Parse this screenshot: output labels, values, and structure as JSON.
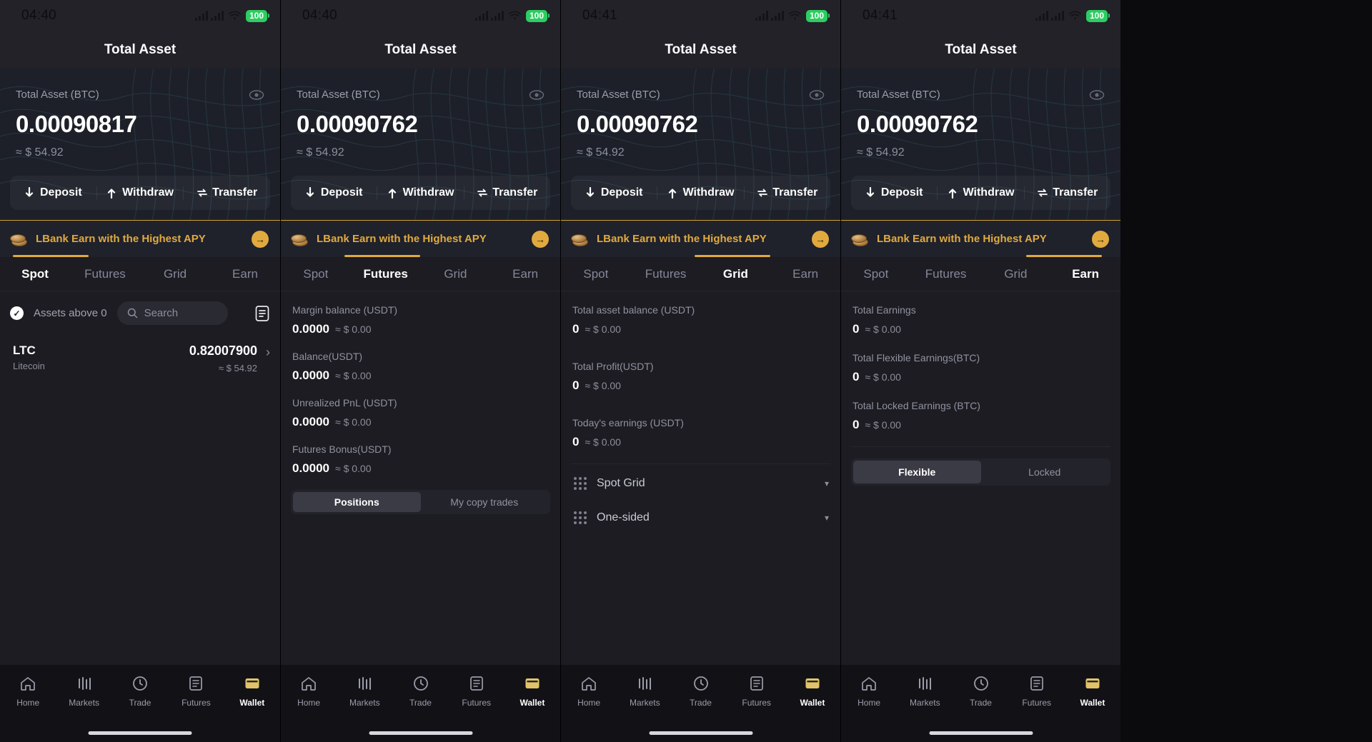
{
  "panels": [
    {
      "statusbar": {
        "time": "04:40",
        "battery": "100"
      },
      "title": "Total Asset",
      "hero": {
        "label": "Total Asset (BTC)",
        "amount": "0.00090817",
        "approx": "≈ $ 54.92",
        "actions": [
          "Deposit",
          "Withdraw",
          "Transfer"
        ]
      },
      "banner": {
        "text": "LBank Earn with the Highest APY",
        "arrow": "→"
      },
      "tabs": [
        "Spot",
        "Futures",
        "Grid",
        "Earn"
      ],
      "active_tab": 0,
      "spot": {
        "filter_label": "Assets above 0",
        "search_placeholder": "Search",
        "asset": {
          "symbol": "LTC",
          "name": "Litecoin",
          "amount": "0.82007900",
          "usd": "≈ $ 54.92"
        }
      },
      "nav": [
        "Home",
        "Markets",
        "Trade",
        "Futures",
        "Wallet"
      ],
      "nav_active": 4
    },
    {
      "statusbar": {
        "time": "04:40",
        "battery": "100"
      },
      "title": "Total Asset",
      "hero": {
        "label": "Total Asset (BTC)",
        "amount": "0.00090762",
        "approx": "≈ $ 54.92",
        "actions": [
          "Deposit",
          "Withdraw",
          "Transfer"
        ]
      },
      "banner": {
        "text": "LBank Earn with the Highest APY",
        "arrow": "→"
      },
      "tabs": [
        "Spot",
        "Futures",
        "Grid",
        "Earn"
      ],
      "active_tab": 1,
      "futures": {
        "stats": [
          {
            "label": "Margin balance (USDT)",
            "value": "0.0000",
            "approx": "≈ $ 0.00"
          },
          {
            "label": "Balance(USDT)",
            "value": "0.0000",
            "approx": "≈ $ 0.00"
          },
          {
            "label": "Unrealized PnL (USDT)",
            "value": "0.0000",
            "approx": "≈ $ 0.00"
          },
          {
            "label": "Futures Bonus(USDT)",
            "value": "0.0000",
            "approx": "≈ $ 0.00"
          }
        ],
        "segments": [
          "Positions",
          "My copy trades"
        ],
        "segment_active": 0
      },
      "nav": [
        "Home",
        "Markets",
        "Trade",
        "Futures",
        "Wallet"
      ],
      "nav_active": 4
    },
    {
      "statusbar": {
        "time": "04:41",
        "battery": "100"
      },
      "title": "Total Asset",
      "hero": {
        "label": "Total Asset (BTC)",
        "amount": "0.00090762",
        "approx": "≈ $ 54.92",
        "actions": [
          "Deposit",
          "Withdraw",
          "Transfer"
        ]
      },
      "banner": {
        "text": "LBank Earn with the Highest APY",
        "arrow": "→"
      },
      "tabs": [
        "Spot",
        "Futures",
        "Grid",
        "Earn"
      ],
      "active_tab": 2,
      "grid": {
        "stats": [
          {
            "label": "Total asset balance (USDT)",
            "value": "0",
            "approx": "≈ $ 0.00"
          },
          {
            "label": "Total Profit(USDT)",
            "value": "0",
            "approx": "≈ $ 0.00"
          },
          {
            "label": "Today's earnings (USDT)",
            "value": "0",
            "approx": "≈ $ 0.00"
          }
        ],
        "rows": [
          {
            "label": "Spot Grid",
            "caret": "▾"
          },
          {
            "label": "One-sided",
            "caret": "▾"
          }
        ]
      },
      "nav": [
        "Home",
        "Markets",
        "Trade",
        "Futures",
        "Wallet"
      ],
      "nav_active": 4
    },
    {
      "statusbar": {
        "time": "04:41",
        "battery": "100"
      },
      "title": "Total Asset",
      "hero": {
        "label": "Total Asset (BTC)",
        "amount": "0.00090762",
        "approx": "≈ $ 54.92",
        "actions": [
          "Deposit",
          "Withdraw",
          "Transfer"
        ]
      },
      "banner": {
        "text": "LBank Earn with the Highest APY",
        "arrow": "→"
      },
      "tabs": [
        "Spot",
        "Futures",
        "Grid",
        "Earn"
      ],
      "active_tab": 3,
      "earn": {
        "stats": [
          {
            "label": "Total Earnings",
            "value": "0",
            "approx": "≈ $ 0.00"
          },
          {
            "label": "Total Flexible Earnings(BTC)",
            "value": "0",
            "approx": "≈ $ 0.00"
          },
          {
            "label": "Total Locked Earnings (BTC)",
            "value": "0",
            "approx": "≈ $ 0.00"
          }
        ],
        "segments": [
          "Flexible",
          "Locked"
        ],
        "segment_active": 0
      },
      "nav": [
        "Home",
        "Markets",
        "Trade",
        "Futures",
        "Wallet"
      ],
      "nav_active": 4
    }
  ],
  "colors": {
    "accent": "#e0aa3e",
    "battery_green": "#2ecc63",
    "panel_bg": "#1c1c22",
    "hero_bg": "#1d2029"
  }
}
